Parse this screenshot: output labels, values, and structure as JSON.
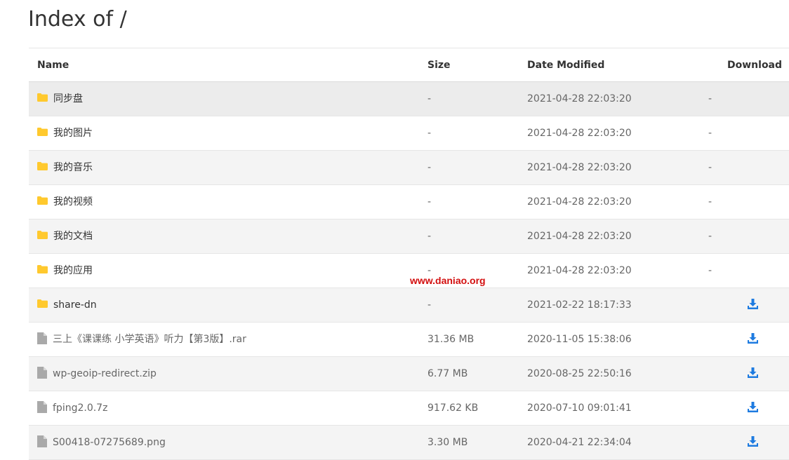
{
  "page": {
    "title": "Index of /"
  },
  "table": {
    "headers": {
      "name": "Name",
      "size": "Size",
      "date": "Date Modified",
      "download": "Download"
    },
    "rows": [
      {
        "type": "folder",
        "name": "同步盘",
        "size": "-",
        "date": "2021-04-28 22:03:20",
        "download": "-"
      },
      {
        "type": "folder",
        "name": "我的图片",
        "size": "-",
        "date": "2021-04-28 22:03:20",
        "download": "-"
      },
      {
        "type": "folder",
        "name": "我的音乐",
        "size": "-",
        "date": "2021-04-28 22:03:20",
        "download": "-"
      },
      {
        "type": "folder",
        "name": "我的视频",
        "size": "-",
        "date": "2021-04-28 22:03:20",
        "download": "-"
      },
      {
        "type": "folder",
        "name": "我的文档",
        "size": "-",
        "date": "2021-04-28 22:03:20",
        "download": "-"
      },
      {
        "type": "folder",
        "name": "我的应用",
        "size": "-",
        "date": "2021-04-28 22:03:20",
        "download": "-"
      },
      {
        "type": "folder",
        "name": "share-dn",
        "size": "-",
        "date": "2021-02-22 18:17:33",
        "download": "download-icon"
      },
      {
        "type": "file",
        "name": "三上《课课练 小学英语》听力【第3版】.rar",
        "size": "31.36 MB",
        "date": "2020-11-05 15:38:06",
        "download": "download-icon"
      },
      {
        "type": "file",
        "name": "wp-geoip-redirect.zip",
        "size": "6.77 MB",
        "date": "2020-08-25 22:50:16",
        "download": "download-icon"
      },
      {
        "type": "file",
        "name": "fping2.0.7z",
        "size": "917.62 KB",
        "date": "2020-07-10 09:01:41",
        "download": "download-icon"
      },
      {
        "type": "file",
        "name": "S00418-07275689.png",
        "size": "3.30 MB",
        "date": "2020-04-21 22:34:04",
        "download": "download-icon"
      }
    ]
  },
  "watermark": "www.daniao.org",
  "colors": {
    "folder": "#ffc92e",
    "file": "#a9a9a9",
    "download": "#1e7be0",
    "watermark": "#d30f0f"
  }
}
